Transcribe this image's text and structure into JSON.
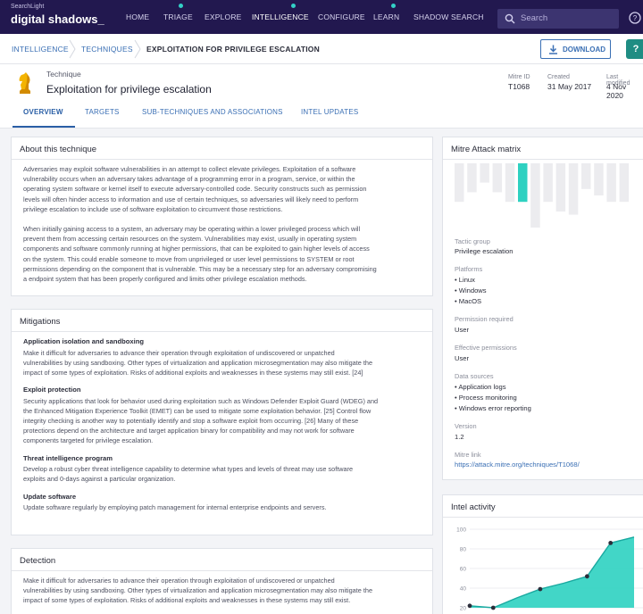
{
  "brand": {
    "small": "SearchLight",
    "name": "digital shadows_"
  },
  "nav": {
    "items": [
      "HOME",
      "TRIAGE",
      "EXPLORE",
      "INTELLIGENCE",
      "CONFIGURE",
      "LEARN",
      "SHADOW SEARCH"
    ],
    "active": "INTELLIGENCE"
  },
  "search": {
    "placeholder": "Search"
  },
  "breadcrumb": [
    "INTELLIGENCE",
    "TECHNIQUES",
    "EXPLOITATION FOR PRIVILEGE ESCALATION"
  ],
  "actions": {
    "download": "DOWNLOAD",
    "help": "?"
  },
  "header": {
    "kicker": "Technique",
    "title": "Exploitation for privilege escalation",
    "meta": [
      {
        "label": "Mitre ID",
        "value": "T1068"
      },
      {
        "label": "Created",
        "value": "31 May 2017"
      },
      {
        "label": "Last modified",
        "value": "4 Nov 2020"
      }
    ]
  },
  "tabs": [
    "OVERVIEW",
    "TARGETS",
    "SUB-TECHNIQUES AND ASSOCIATIONS",
    "INTEL UPDATES"
  ],
  "about": {
    "title": "About this technique",
    "paragraphs": [
      [
        "Adversaries may exploit software vulnerabilities in an attempt to collect elevate privileges. Exploitation of a software",
        "vulnerability occurs when an adversary takes advantage of a programming error in a program, service, or within the",
        "operating system software or kernel itself to execute adversary-controlled code. Security constructs such as permission",
        "levels will often hinder access to information and use of certain techniques, so adversaries will likely need to perform",
        "privilege escalation to include use of software exploitation to circumvent those restrictions."
      ],
      [
        "When initially gaining access to a system, an adversary may be operating within a lower privileged process which will",
        "prevent them from accessing certain resources on the system. Vulnerabilities may exist, usually in operating system",
        "components and software commonly running at higher permissions, that can be exploited to gain higher levels of access",
        "on the system. This could enable someone to move from unprivileged or user level permissions to SYSTEM or root",
        "permissions depending on the component that is vulnerable. This may be a necessary step for an adversary compromising",
        "a endpoint system that has been properly configured and limits other privilege escalation methods."
      ]
    ]
  },
  "mitigations": {
    "title": "Mitigations",
    "items": [
      {
        "title": "Application isolation and sandboxing",
        "lines": [
          "Make it difficult for adversaries to advance their operation through exploitation of undiscovered or unpatched",
          "vulnerabilities by using sandboxing. Other types of virtualization and application microsegmentation may also mitigate the",
          "impact of some types of exploitation. Risks of additional exploits and weaknesses in these systems may still exist. [24]"
        ]
      },
      {
        "title": "Exploit protection",
        "lines": [
          "Security applications that look for behavior used during exploitation such as Windows Defender Exploit Guard (WDEG) and",
          "the Enhanced Mitigation Experience Toolkit (EMET) can be used to mitigate some exploitation behavior. [25] Control flow",
          "integrity checking is another way to potentially identify and stop a software exploit from occurring. [26] Many of these",
          "protections depend on the architecture and target application binary for compatibility and may not work for software",
          "components targeted for privilege escalation."
        ]
      },
      {
        "title": "Threat intelligence program",
        "lines": [
          "Develop a robust cyber threat intelligence capability to determine what types and levels of threat may use software",
          "exploits and 0-days against a particular organization."
        ]
      },
      {
        "title": "Update software",
        "lines": [
          "Update software regularly by employing patch management for internal enterprise endpoints and servers."
        ]
      }
    ]
  },
  "detection": {
    "title": "Detection",
    "lines": [
      "Make it difficult for adversaries to advance their operation through exploitation of undiscovered or unpatched",
      "vulnerabilities by using sandboxing. Other types of virtualization and application microsegmentation may also mitigate the",
      "impact of some types of exploitation. Risks of additional exploits and weaknesses in these systems may still exist."
    ]
  },
  "matrix": {
    "title": "Mitre Attack matrix",
    "columns": [
      {
        "level": 0.6,
        "highlight": false
      },
      {
        "level": 0.45,
        "highlight": false
      },
      {
        "level": 0.3,
        "highlight": false
      },
      {
        "level": 0.45,
        "highlight": false
      },
      {
        "level": 0.6,
        "highlight": false
      },
      {
        "level": 0.6,
        "highlight": true
      },
      {
        "level": 1.0,
        "highlight": false
      },
      {
        "level": 0.6,
        "highlight": false
      },
      {
        "level": 0.75,
        "highlight": false
      },
      {
        "level": 0.8,
        "highlight": false
      },
      {
        "level": 0.4,
        "highlight": false
      },
      {
        "level": 0.5,
        "highlight": false
      },
      {
        "level": 0.6,
        "highlight": false
      },
      {
        "level": 0.6,
        "highlight": false
      }
    ],
    "bar_color": "#ececef",
    "highlight_color": "#2ed1c1"
  },
  "details": {
    "tactic_label": "Tactic group",
    "tactic_value": "Privilege escalation",
    "platforms_label": "Platforms",
    "platforms": [
      "Linux",
      "Windows",
      "MacOS"
    ],
    "permission_label": "Permission required",
    "permission_value": "User",
    "effective_label": "Effective permissions",
    "effective_value": "User",
    "sources_label": "Data sources",
    "sources": [
      "Application logs",
      "Process monitoring",
      "Windows error reporting"
    ],
    "version_label": "Version",
    "version_value": "1.2",
    "link_label": "Mitre link",
    "link_value": "https://attack.mitre.org/techniques/T1068/"
  },
  "intel_activity": {
    "title": "Intel activity"
  },
  "chart_data": {
    "type": "area",
    "title": "Intel activity",
    "yticks": [
      20,
      40,
      60,
      80,
      100
    ],
    "ylim": [
      20,
      100
    ],
    "x": [
      1,
      2,
      3,
      4,
      5,
      6,
      7,
      8
    ],
    "values": [
      22,
      20,
      30,
      39,
      45,
      52,
      86,
      92
    ],
    "markers": [
      true,
      true,
      false,
      true,
      false,
      true,
      true,
      false
    ],
    "color": "#2ed1c1"
  }
}
